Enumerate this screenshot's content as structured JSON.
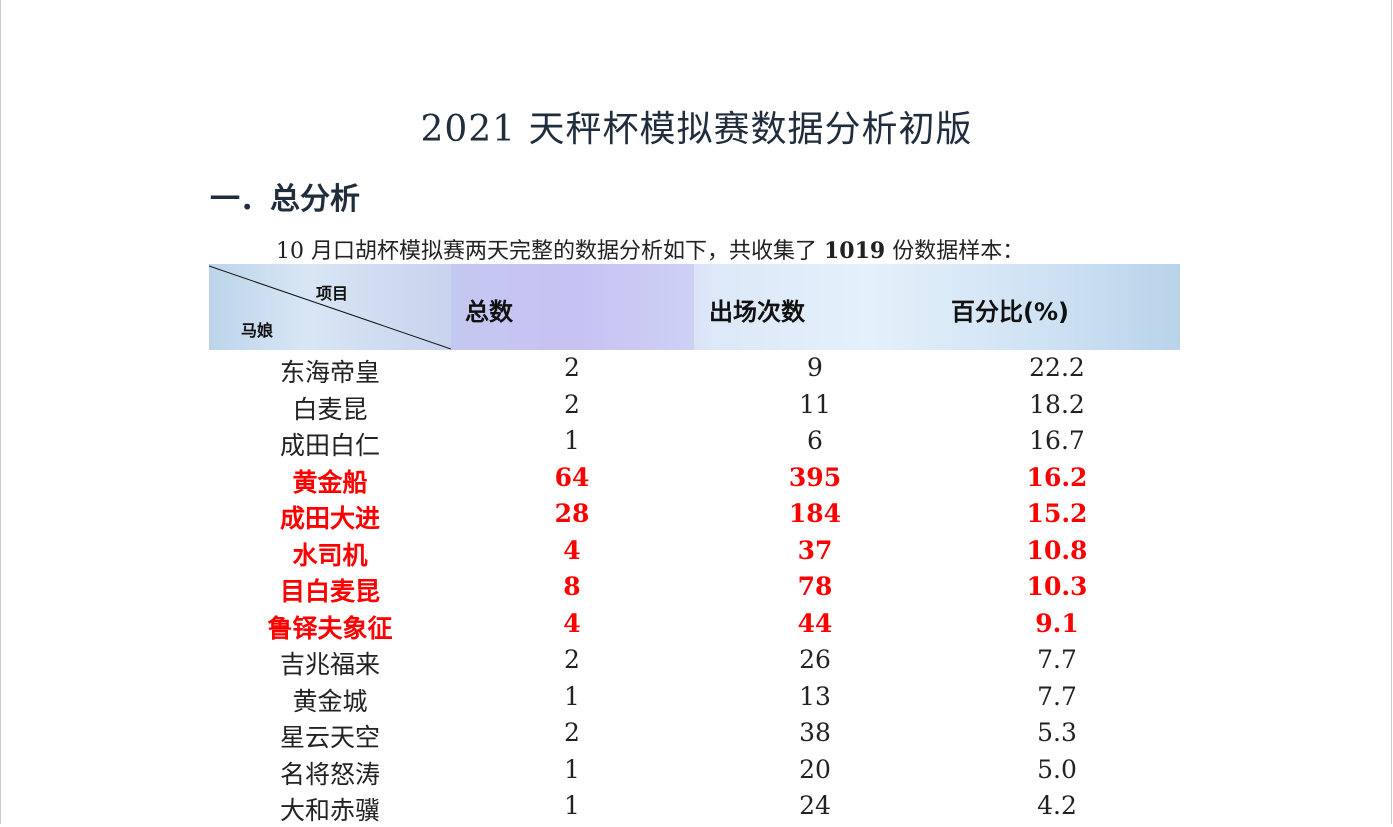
{
  "document": {
    "title": "2021 天秤杯模拟赛数据分析初版",
    "section_heading": "一．总分析",
    "intro_prefix": "10 月口胡杯模拟赛两天完整的数据分析如下，共收集了 ",
    "intro_count": "1019",
    "intro_suffix": " 份数据样本："
  },
  "table": {
    "corner_top_label": "项目",
    "corner_bottom_label": "马娘",
    "columns": [
      "总数",
      "出场次数",
      "百分比(%)"
    ],
    "rows": [
      {
        "name": "东海帝皇",
        "total": "2",
        "appearances": "9",
        "percent": "22.2",
        "highlight": false
      },
      {
        "name": "白麦昆",
        "total": "2",
        "appearances": "11",
        "percent": "18.2",
        "highlight": false
      },
      {
        "name": "成田白仁",
        "total": "1",
        "appearances": "6",
        "percent": "16.7",
        "highlight": false
      },
      {
        "name": "黄金船",
        "total": "64",
        "appearances": "395",
        "percent": "16.2",
        "highlight": true
      },
      {
        "name": "成田大进",
        "total": "28",
        "appearances": "184",
        "percent": "15.2",
        "highlight": true
      },
      {
        "name": "水司机",
        "total": "4",
        "appearances": "37",
        "percent": "10.8",
        "highlight": true
      },
      {
        "name": "目白麦昆",
        "total": "8",
        "appearances": "78",
        "percent": "10.3",
        "highlight": true
      },
      {
        "name": "鲁铎夫象征",
        "total": "4",
        "appearances": "44",
        "percent": "9.1",
        "highlight": true
      },
      {
        "name": "吉兆福来",
        "total": "2",
        "appearances": "26",
        "percent": "7.7",
        "highlight": false
      },
      {
        "name": "黄金城",
        "total": "1",
        "appearances": "13",
        "percent": "7.7",
        "highlight": false
      },
      {
        "name": "星云天空",
        "total": "2",
        "appearances": "38",
        "percent": "5.3",
        "highlight": false
      },
      {
        "name": "名将怒涛",
        "total": "1",
        "appearances": "20",
        "percent": "5.0",
        "highlight": false
      },
      {
        "name": "大和赤骥",
        "total": "1",
        "appearances": "24",
        "percent": "4.2",
        "highlight": false
      }
    ]
  },
  "colors": {
    "title": "#1f2d3d",
    "highlight": "#ff0000",
    "header_bg": "#cfe2f3"
  }
}
